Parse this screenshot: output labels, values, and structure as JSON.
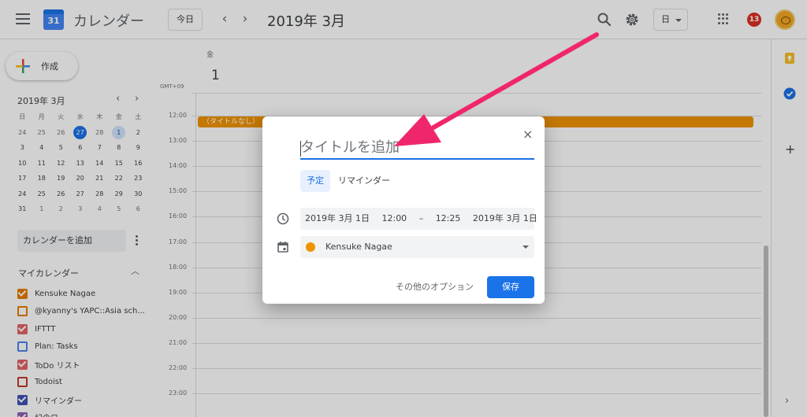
{
  "header": {
    "app_title": "カレンダー",
    "logo_day": "31",
    "today_label": "今日",
    "prev_label": "‹",
    "next_label": "›",
    "month_title": "2019年 3月",
    "view_label": "日",
    "notification_count": "13"
  },
  "sidebar": {
    "create_label": "作成",
    "mini_calendar": {
      "title": "2019年 3月",
      "prev": "‹",
      "next": "›",
      "weekdays": [
        "日",
        "月",
        "火",
        "水",
        "木",
        "金",
        "土"
      ],
      "weeks": [
        [
          "24",
          "25",
          "26",
          "27",
          "28",
          "1",
          "2"
        ],
        [
          "3",
          "4",
          "5",
          "6",
          "7",
          "8",
          "9"
        ],
        [
          "10",
          "11",
          "12",
          "13",
          "14",
          "15",
          "16"
        ],
        [
          "17",
          "18",
          "19",
          "20",
          "21",
          "22",
          "23"
        ],
        [
          "24",
          "25",
          "26",
          "27",
          "28",
          "29",
          "30"
        ],
        [
          "31",
          "1",
          "2",
          "3",
          "4",
          "5",
          "6"
        ]
      ]
    },
    "add_calendar_label": "カレンダーを追加",
    "my_calendars_title": "マイカレンダー",
    "calendars": [
      {
        "label": "Kensuke Nagae",
        "color": "#e67c00",
        "checked": true
      },
      {
        "label": "@kyanny's YAPC::Asia sch...",
        "color": "#e67c00",
        "checked": false
      },
      {
        "label": "IFTTT",
        "color": "#e06666",
        "checked": true
      },
      {
        "label": "Plan: Tasks",
        "color": "#4a86e8",
        "checked": false
      },
      {
        "label": "ToDo リスト",
        "color": "#e06666",
        "checked": true
      },
      {
        "label": "Todoist",
        "color": "#c0392b",
        "checked": false
      },
      {
        "label": "リマインダー",
        "color": "#3f51b5",
        "checked": true
      },
      {
        "label": "記念日",
        "color": "#8e63b5",
        "checked": true
      }
    ]
  },
  "main": {
    "day_of_week": "金",
    "day_number": "1",
    "timezone": "GMT+09",
    "hours": [
      "12:00",
      "13:00",
      "14:00",
      "15:00",
      "16:00",
      "17:00",
      "18:00",
      "19:00",
      "20:00",
      "21:00",
      "22:00",
      "23:00"
    ],
    "event_label": "（タイトルなし）"
  },
  "dialog": {
    "title_placeholder": "タイトルを追加",
    "tab_event": "予定",
    "tab_reminder": "リマインダー",
    "start_date": "2019年 3月 1日",
    "start_time": "12:00",
    "dash": "–",
    "end_time": "12:25",
    "end_date": "2019年 3月 1日",
    "calendar_name": "Kensuke Nagae",
    "more_options": "その他のオプション",
    "save_label": "保存",
    "close_label": "×"
  },
  "colors": {
    "accent": "#1a73e8",
    "event": "#f09300",
    "arrow": "#f0266d"
  }
}
